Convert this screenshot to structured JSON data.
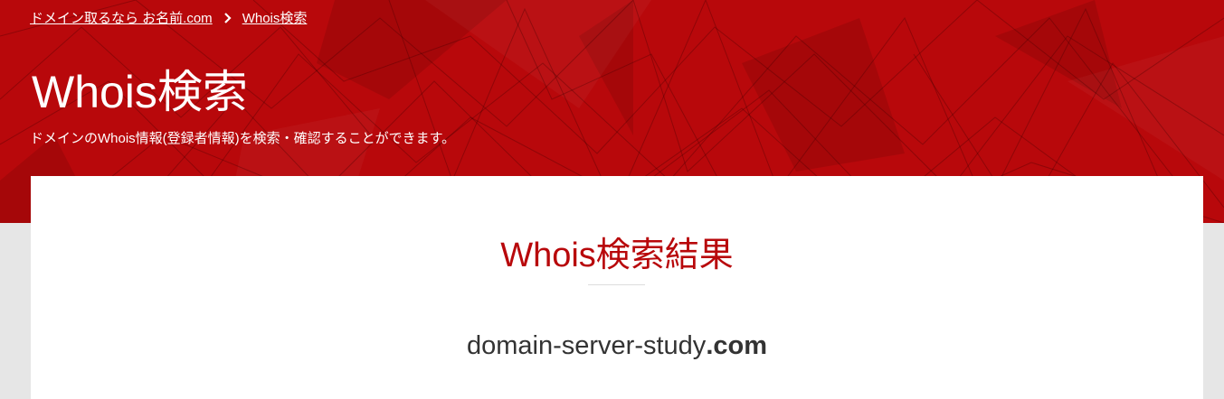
{
  "breadcrumb": {
    "home_label": "ドメイン取るなら お名前.com",
    "current_label": "Whois検索",
    "separator_icon": "chevron-right-icon"
  },
  "header": {
    "title": "Whois検索",
    "description": "ドメインのWhois情報(登録者情報)を検索・確認することができます。"
  },
  "result": {
    "title": "Whois検索結果",
    "domain_name": "domain-server-study",
    "domain_tld": ".com"
  },
  "colors": {
    "brand_red": "#b8080b",
    "page_bg": "#e6e6e6",
    "card_bg": "#ffffff",
    "text_dark": "#333333"
  }
}
